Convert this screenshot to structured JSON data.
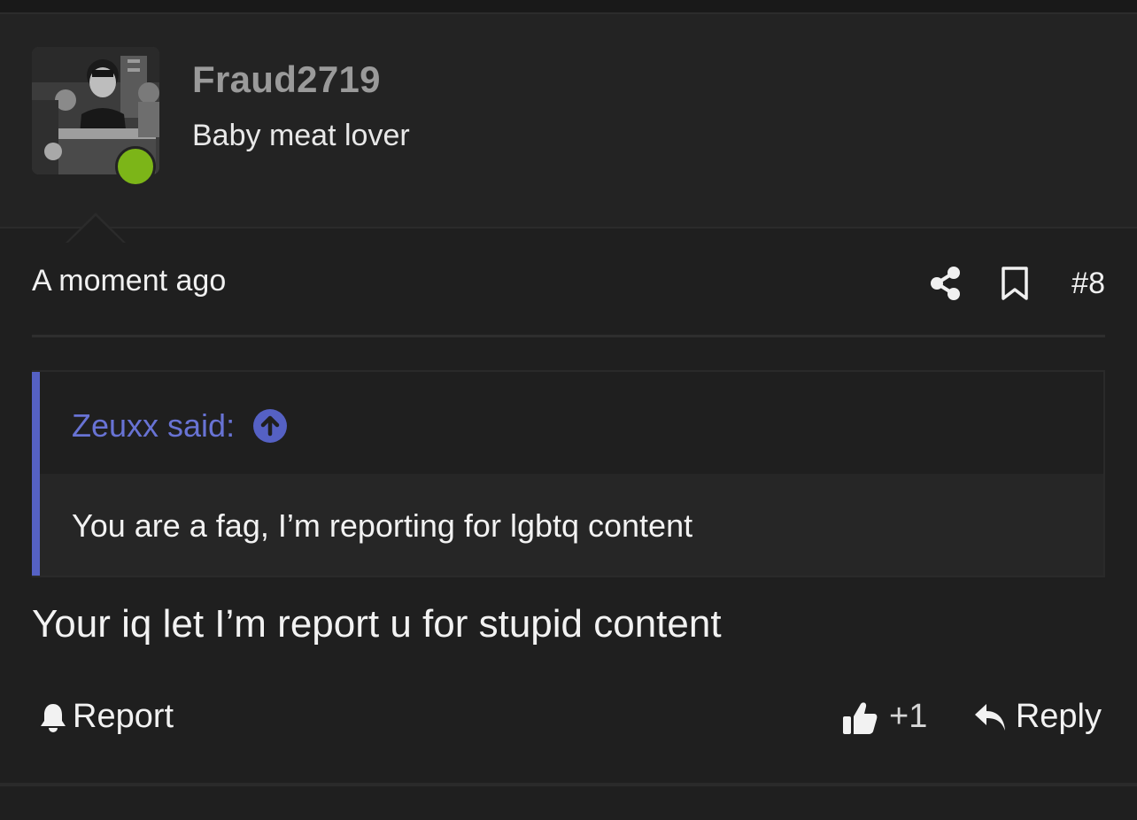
{
  "user": {
    "username": "Fraud2719",
    "title": "Baby meat lover",
    "online": true,
    "status_color": "#7cb518"
  },
  "post": {
    "time": "A moment ago",
    "number": "#8",
    "icons": {
      "share": "share-icon",
      "bookmark": "bookmark-icon"
    },
    "quote": {
      "author": "Zeuxx said:",
      "jump_icon": "arrow-up-circle-icon",
      "text": "You are a fag, I’m reporting for lgbtq content",
      "accent_color": "#5561c4"
    },
    "body": "Your iq let I’m report u for stupid content"
  },
  "actions": {
    "report_label": "Report",
    "like_count": "+1",
    "reply_label": "Reply",
    "icons": {
      "report": "bell-icon",
      "like": "thumbs-up-icon",
      "reply": "reply-icon"
    }
  }
}
